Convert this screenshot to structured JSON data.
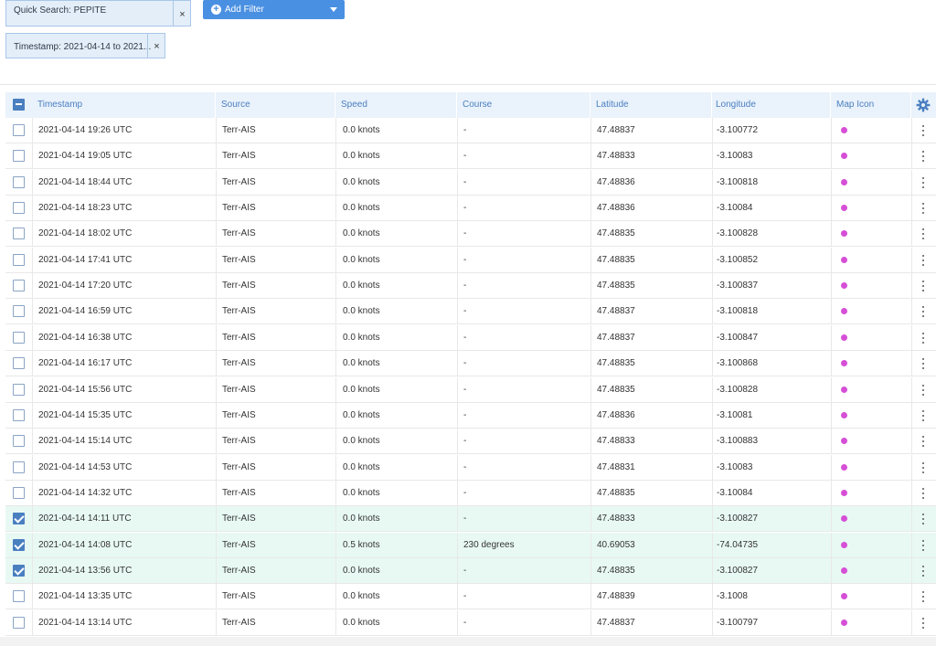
{
  "filters": {
    "quick_search": "Quick Search: PEPITE",
    "timestamp": "Timestamp: 2021-04-14 to 2021...",
    "close_glyph": "×",
    "add_filter_label": "Add Filter",
    "add_filter_icon": "plus-circle-icon"
  },
  "colors": {
    "accent": "#4a7fc0",
    "button": "#4a90e2",
    "selected_row": "#e8f9f4",
    "map_dot": "#d64fd6"
  },
  "table": {
    "columns": [
      "Timestamp",
      "Source",
      "Speed",
      "Course",
      "Latitude",
      "Longitude",
      "Map Icon"
    ],
    "settings_icon": "gear-icon",
    "rows": [
      {
        "timestamp": "2021-04-14 19:26 UTC",
        "source": "Terr-AIS",
        "speed": "0.0 knots",
        "course": "-",
        "latitude": "47.48837",
        "longitude": "-3.100772",
        "selected": false
      },
      {
        "timestamp": "2021-04-14 19:05 UTC",
        "source": "Terr-AIS",
        "speed": "0.0 knots",
        "course": "-",
        "latitude": "47.48833",
        "longitude": "-3.10083",
        "selected": false
      },
      {
        "timestamp": "2021-04-14 18:44 UTC",
        "source": "Terr-AIS",
        "speed": "0.0 knots",
        "course": "-",
        "latitude": "47.48836",
        "longitude": "-3.100818",
        "selected": false
      },
      {
        "timestamp": "2021-04-14 18:23 UTC",
        "source": "Terr-AIS",
        "speed": "0.0 knots",
        "course": "-",
        "latitude": "47.48836",
        "longitude": "-3.10084",
        "selected": false
      },
      {
        "timestamp": "2021-04-14 18:02 UTC",
        "source": "Terr-AIS",
        "speed": "0.0 knots",
        "course": "-",
        "latitude": "47.48835",
        "longitude": "-3.100828",
        "selected": false
      },
      {
        "timestamp": "2021-04-14 17:41 UTC",
        "source": "Terr-AIS",
        "speed": "0.0 knots",
        "course": "-",
        "latitude": "47.48835",
        "longitude": "-3.100852",
        "selected": false
      },
      {
        "timestamp": "2021-04-14 17:20 UTC",
        "source": "Terr-AIS",
        "speed": "0.0 knots",
        "course": "-",
        "latitude": "47.48835",
        "longitude": "-3.100837",
        "selected": false
      },
      {
        "timestamp": "2021-04-14 16:59 UTC",
        "source": "Terr-AIS",
        "speed": "0.0 knots",
        "course": "-",
        "latitude": "47.48837",
        "longitude": "-3.100818",
        "selected": false
      },
      {
        "timestamp": "2021-04-14 16:38 UTC",
        "source": "Terr-AIS",
        "speed": "0.0 knots",
        "course": "-",
        "latitude": "47.48837",
        "longitude": "-3.100847",
        "selected": false
      },
      {
        "timestamp": "2021-04-14 16:17 UTC",
        "source": "Terr-AIS",
        "speed": "0.0 knots",
        "course": "-",
        "latitude": "47.48835",
        "longitude": "-3.100868",
        "selected": false
      },
      {
        "timestamp": "2021-04-14 15:56 UTC",
        "source": "Terr-AIS",
        "speed": "0.0 knots",
        "course": "-",
        "latitude": "47.48835",
        "longitude": "-3.100828",
        "selected": false
      },
      {
        "timestamp": "2021-04-14 15:35 UTC",
        "source": "Terr-AIS",
        "speed": "0.0 knots",
        "course": "-",
        "latitude": "47.48836",
        "longitude": "-3.10081",
        "selected": false
      },
      {
        "timestamp": "2021-04-14 15:14 UTC",
        "source": "Terr-AIS",
        "speed": "0.0 knots",
        "course": "-",
        "latitude": "47.48833",
        "longitude": "-3.100883",
        "selected": false
      },
      {
        "timestamp": "2021-04-14 14:53 UTC",
        "source": "Terr-AIS",
        "speed": "0.0 knots",
        "course": "-",
        "latitude": "47.48831",
        "longitude": "-3.10083",
        "selected": false
      },
      {
        "timestamp": "2021-04-14 14:32 UTC",
        "source": "Terr-AIS",
        "speed": "0.0 knots",
        "course": "-",
        "latitude": "47.48835",
        "longitude": "-3.10084",
        "selected": false
      },
      {
        "timestamp": "2021-04-14 14:11 UTC",
        "source": "Terr-AIS",
        "speed": "0.0 knots",
        "course": "-",
        "latitude": "47.48833",
        "longitude": "-3.100827",
        "selected": true
      },
      {
        "timestamp": "2021-04-14 14:08 UTC",
        "source": "Terr-AIS",
        "speed": "0.5 knots",
        "course": "230 degrees",
        "latitude": "40.69053",
        "longitude": "-74.04735",
        "selected": true
      },
      {
        "timestamp": "2021-04-14 13:56 UTC",
        "source": "Terr-AIS",
        "speed": "0.0 knots",
        "course": "-",
        "latitude": "47.48835",
        "longitude": "-3.100827",
        "selected": true
      },
      {
        "timestamp": "2021-04-14 13:35 UTC",
        "source": "Terr-AIS",
        "speed": "0.0 knots",
        "course": "-",
        "latitude": "47.48839",
        "longitude": "-3.1008",
        "selected": false
      },
      {
        "timestamp": "2021-04-14 13:14 UTC",
        "source": "Terr-AIS",
        "speed": "0.0 knots",
        "course": "-",
        "latitude": "47.48837",
        "longitude": "-3.100797",
        "selected": false
      }
    ]
  }
}
